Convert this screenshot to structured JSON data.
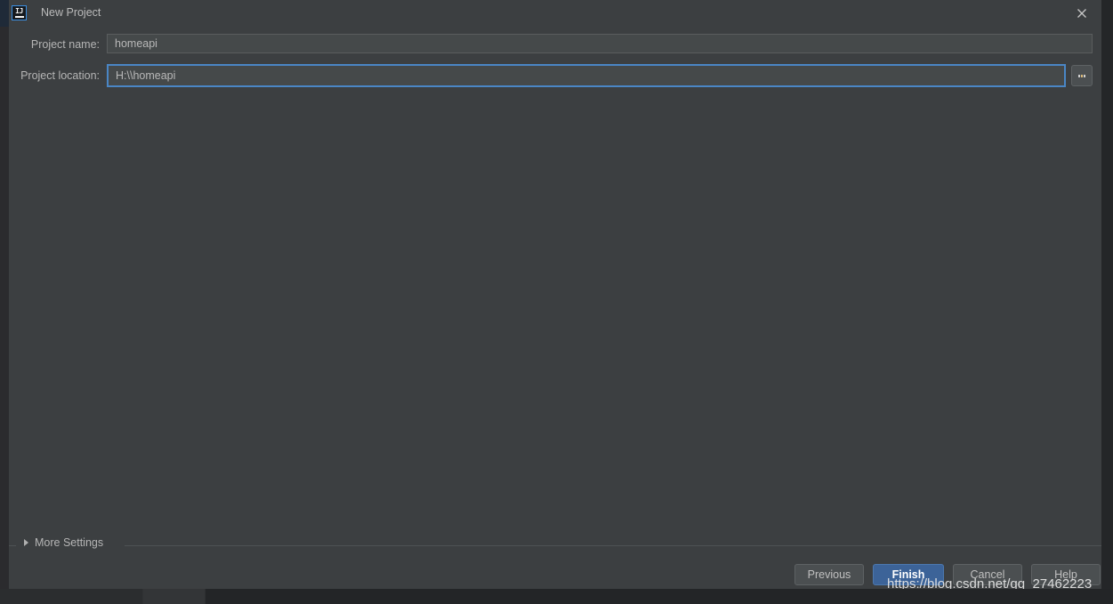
{
  "window": {
    "title": "New Project",
    "app_icon": "intellij-idea-icon",
    "close_icon": "close-icon"
  },
  "form": {
    "fields": [
      {
        "label": "Project name:",
        "value": "homeapi",
        "placeholder": "",
        "focused": false
      },
      {
        "label": "Project location:",
        "value": "H:\\\\homeapi",
        "placeholder": "",
        "focused": true
      }
    ],
    "browse_button": {
      "label": "...",
      "icon": "ellipsis-icon"
    }
  },
  "more_settings": {
    "label": "More Settings",
    "expanded": false,
    "chevron_icon": "triangle-right-icon"
  },
  "footer": {
    "buttons": [
      {
        "label": "Previous",
        "primary": false
      },
      {
        "label": "Finish",
        "primary": true
      },
      {
        "label": "Cancel",
        "primary": false
      },
      {
        "label": "Help",
        "primary": false
      }
    ]
  },
  "watermark": {
    "text": "https://blog.csdn.net/qq_27462223"
  },
  "colors": {
    "dialog_background": "#3c3f41",
    "input_background": "#45494a",
    "focus_border": "#4a86c5",
    "primary_button": "#3c6398",
    "text": "#b5b5b5"
  }
}
